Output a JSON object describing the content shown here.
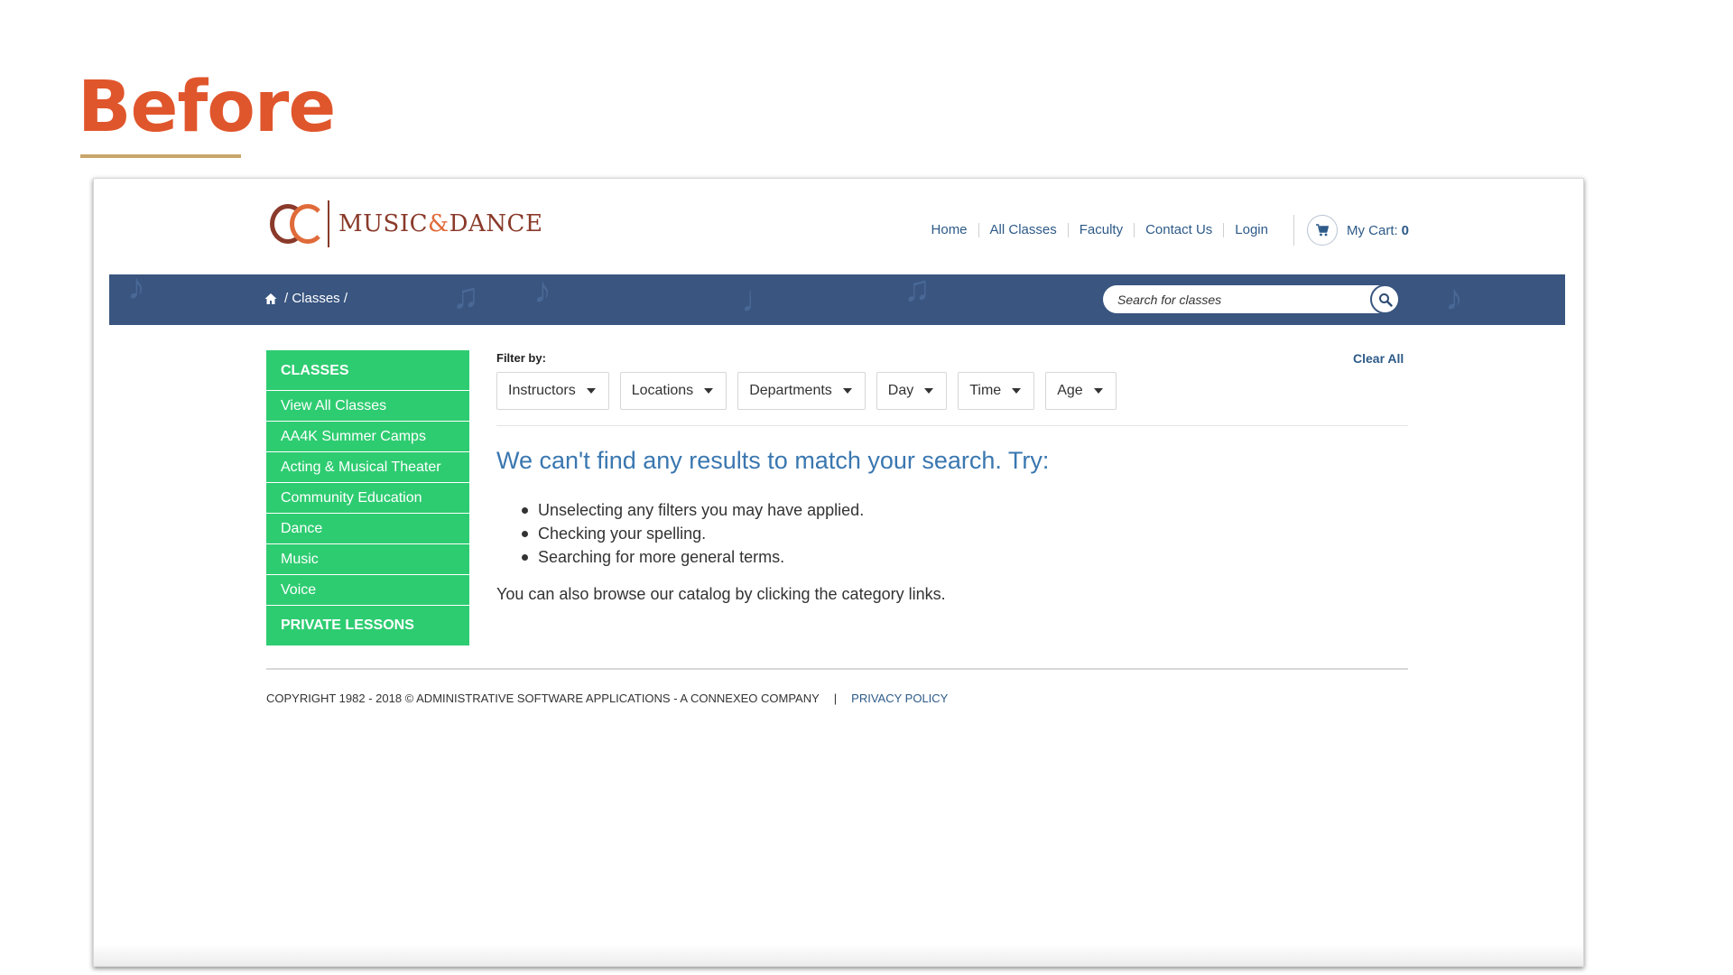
{
  "slide": {
    "title": "Before"
  },
  "logo": {
    "text_a": "MUSIC",
    "clef": "&",
    "text_b": "DANCE"
  },
  "nav": {
    "links": [
      "Home",
      "All Classes",
      "Faculty",
      "Contact Us",
      "Login"
    ],
    "cart_label": "My Cart:",
    "cart_count": "0"
  },
  "breadcrumb": {
    "text": "/ Classes /"
  },
  "search": {
    "placeholder": "Search for classes"
  },
  "sidebar": {
    "heading": "CLASSES",
    "items": [
      "View All Classes",
      "AA4K Summer Camps",
      "Acting & Musical Theater",
      "Community Education",
      "Dance",
      "Music",
      "Voice"
    ],
    "footer_heading": "PRIVATE LESSONS"
  },
  "filters": {
    "label": "Filter by:",
    "clear_all": "Clear All",
    "options": [
      "Instructors",
      "Locations",
      "Departments",
      "Day",
      "Time",
      "Age"
    ]
  },
  "results": {
    "message": "We can't find any results to match your search. Try:",
    "tips": [
      "Unselecting any filters you may have applied.",
      "Checking your spelling.",
      "Searching for more general terms."
    ],
    "browse": "You can also browse our catalog by clicking the category links."
  },
  "footer": {
    "copyright": "COPYRIGHT 1982 - 2018 © ADMINISTRATIVE SOFTWARE APPLICATIONS - A CONNEXEO COMPANY",
    "separator": "|",
    "privacy": "PRIVACY POLICY"
  },
  "colors": {
    "title": "#e0562c",
    "banner": "#395580",
    "sidebar": "#2ecc71",
    "link": "#2d5a88",
    "results": "#3a77b0"
  }
}
